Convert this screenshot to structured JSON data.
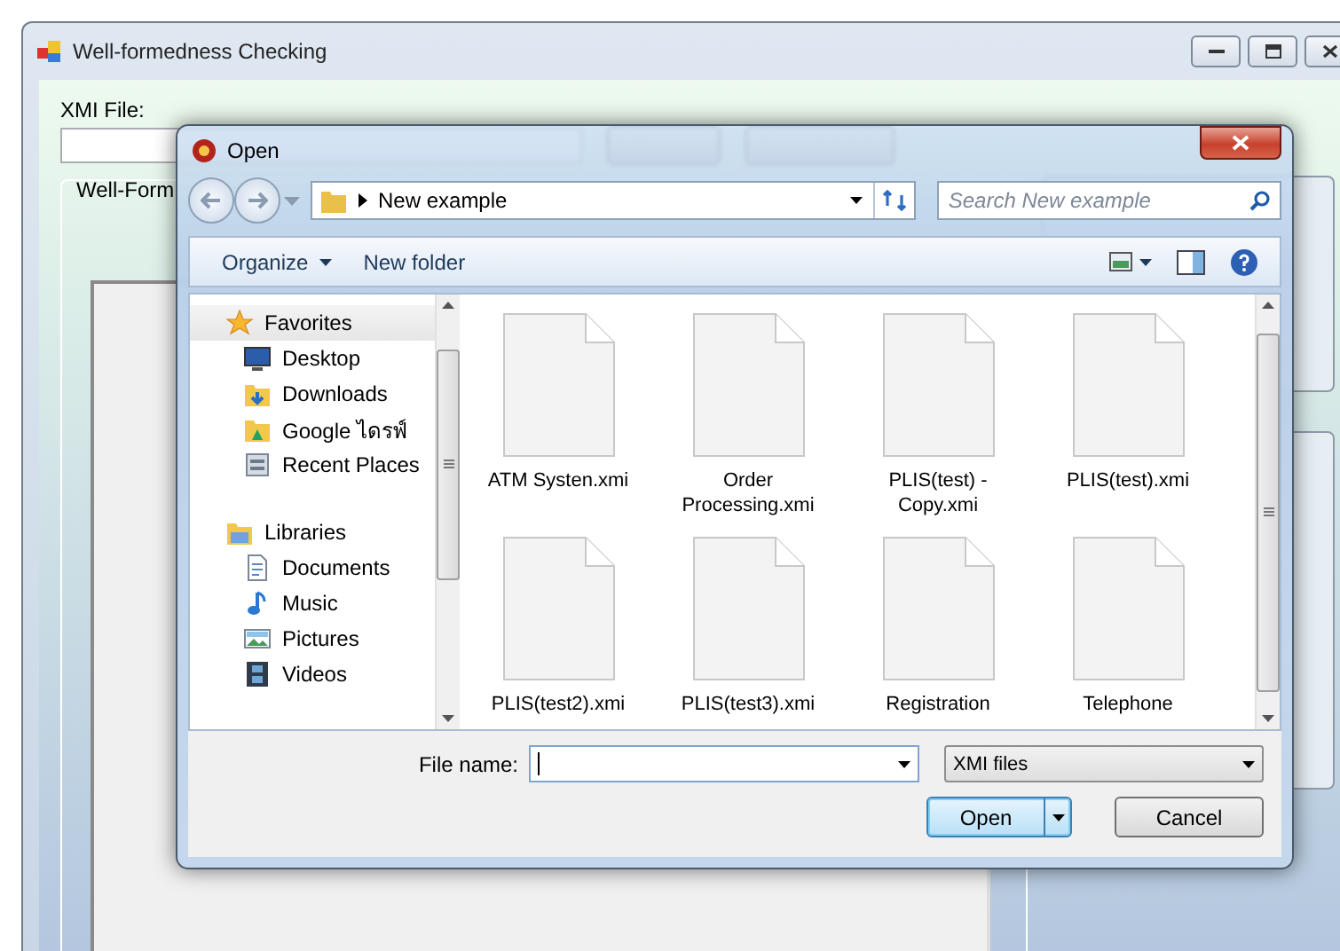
{
  "window": {
    "title": "Well-formedness Checking"
  },
  "form": {
    "xmi_label": "XMI File:",
    "group_label": "Well-Form"
  },
  "dialog": {
    "title": "Open",
    "path": "New example",
    "search": {
      "placeholder": "Search New example"
    },
    "toolbar": [
      "Organize",
      "New folder"
    ],
    "nav": [
      {
        "label": "Favorites",
        "selected": true,
        "children": [
          {
            "label": "Desktop",
            "selected": false
          },
          {
            "label": "Downloads",
            "selected": false
          },
          {
            "label": "Google ไดรฟ์",
            "selected": false
          },
          {
            "label": "Recent Places",
            "selected": false
          }
        ]
      },
      {
        "label": "Libraries",
        "selected": false,
        "children": [
          {
            "label": "Documents",
            "selected": false
          },
          {
            "label": "Music",
            "selected": false
          },
          {
            "label": "Pictures",
            "selected": false
          },
          {
            "label": "Videos",
            "selected": false
          }
        ]
      }
    ],
    "files": [
      "ATM Systen.xmi",
      "Order Processing.xmi",
      "PLIS(test) - Copy.xmi",
      "PLIS(test).xmi",
      "PLIS(test2).xmi",
      "PLIS(test3).xmi",
      "Registration",
      "Telephone"
    ],
    "file_name": {
      "label": "File name:"
    },
    "file_type": "XMI files",
    "buttons": [
      "Open",
      "Cancel"
    ]
  }
}
